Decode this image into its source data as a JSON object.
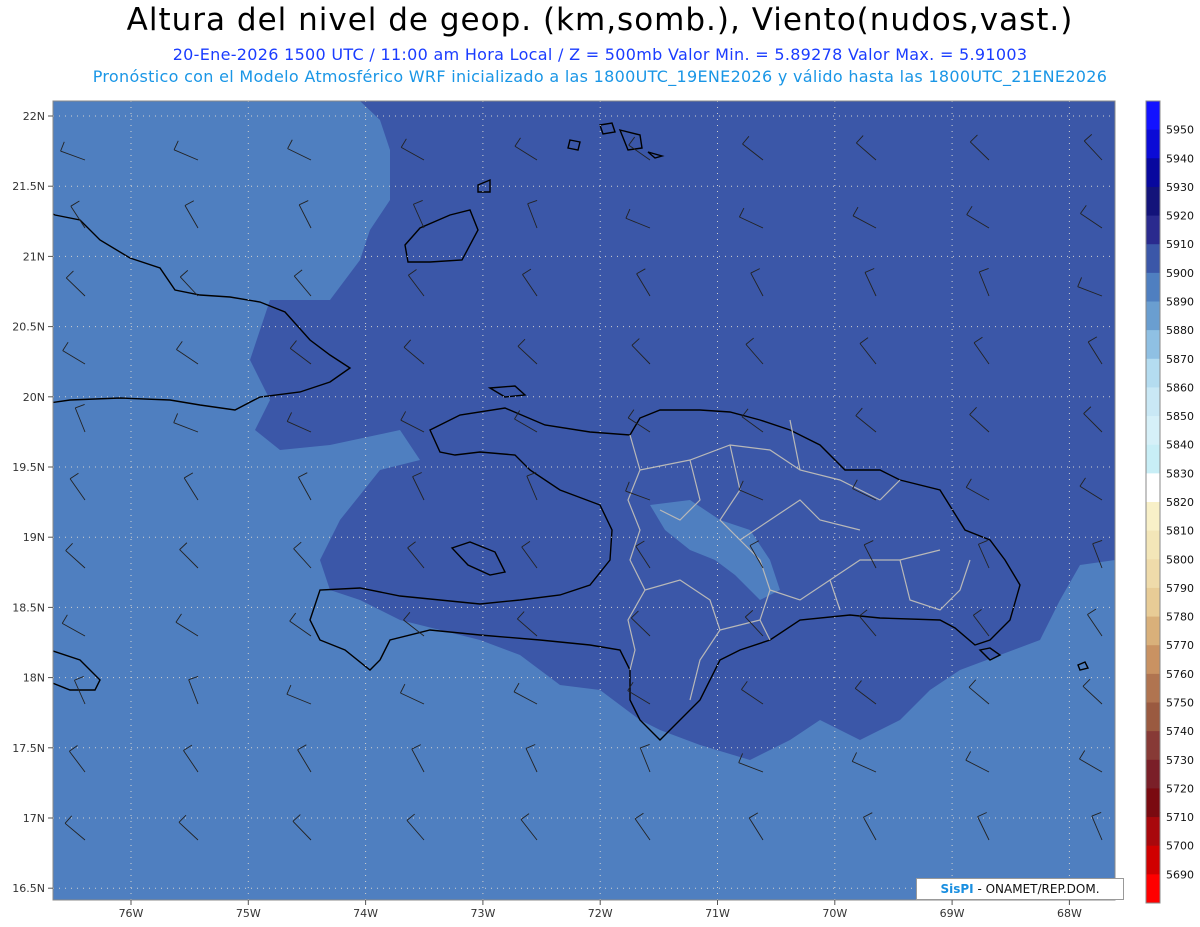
{
  "header": {
    "title": "Altura del nivel de geop. (km,somb.), Viento(nudos,vast.)",
    "subtitle_1": "20-Ene-2026  1500 UTC / 11:00 am Hora Local / Z = 500mb    Valor Min. = 5.89278  Valor Max. = 5.91003",
    "subtitle_2": "Pronóstico con el Modelo Atmosférico WRF inicializado a las 1800UTC_19ENE2026 y válido hasta las  1800UTC_21ENE2026"
  },
  "map": {
    "ocean_color": "#4f7fc0",
    "land_color": "#3b57a8",
    "coast_color": "#000000",
    "province_border_color": "#b8b8b8",
    "lat_labels": [
      "22N",
      "21.5N",
      "21N",
      "20.5N",
      "20N",
      "19.5N",
      "19N",
      "18.5N",
      "18N",
      "17.5N",
      "17N",
      "16.5N"
    ],
    "lon_labels": [
      "76W",
      "75W",
      "74W",
      "73W",
      "72W",
      "71W",
      "70W",
      "69W",
      "68W"
    ]
  },
  "colorbar": {
    "levels": [
      "5950",
      "5940",
      "5930",
      "5920",
      "5910",
      "5900",
      "5890",
      "5880",
      "5870",
      "5860",
      "5850",
      "5840",
      "5830",
      "5820",
      "5810",
      "5800",
      "5790",
      "5780",
      "5770",
      "5760",
      "5750",
      "5740",
      "5730",
      "5720",
      "5710",
      "5700",
      "5690"
    ],
    "colors": [
      "#1212ff",
      "#0b0bd6",
      "#08089e",
      "#13137a",
      "#2a2a8e",
      "#3b57a8",
      "#4f7fc0",
      "#6a9ed0",
      "#8fc0e3",
      "#b4dcf0",
      "#c9e8f5",
      "#d6f0f8",
      "#c8eef6",
      "#ffffff",
      "#f8f0c8",
      "#f3e6b8",
      "#efdbaa",
      "#e8cc96",
      "#d9b07a",
      "#c99262",
      "#b07450",
      "#9a5a40",
      "#873a36",
      "#7a1f28",
      "#7a0a10",
      "#a8080c",
      "#d00000",
      "#ff0000"
    ]
  },
  "credit": {
    "logo": "SisPI",
    "text": "- ONAMET/REP.DOM."
  }
}
